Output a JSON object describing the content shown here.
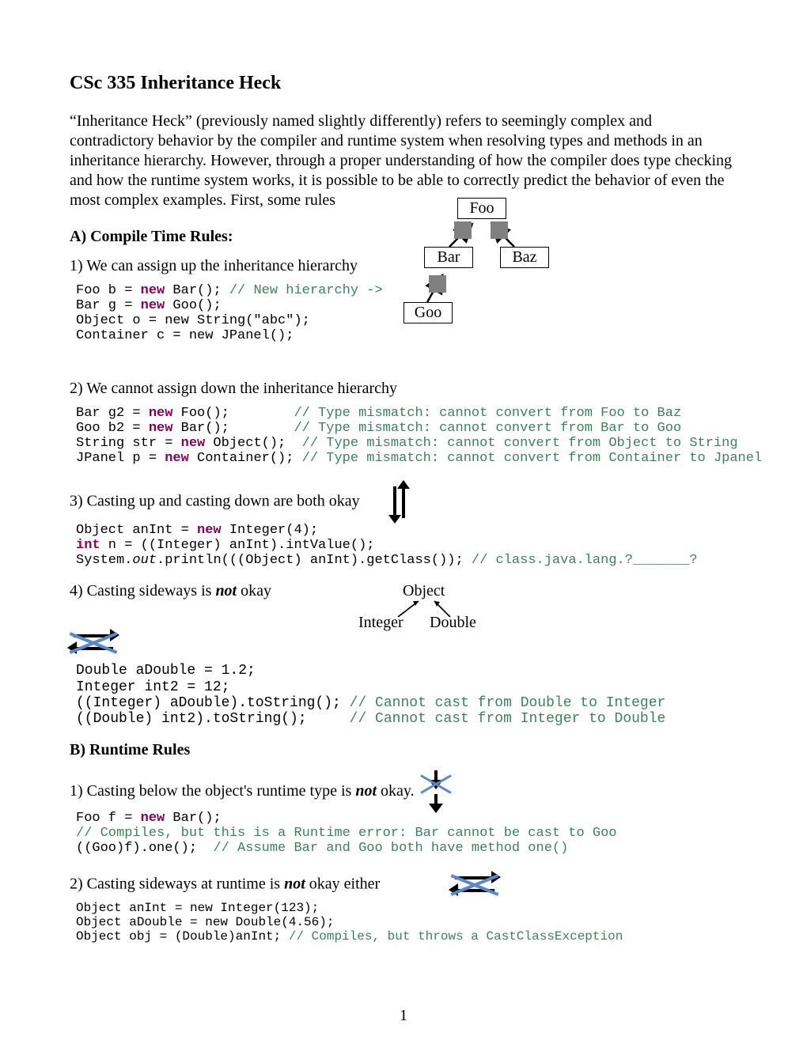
{
  "title": "CSc 335 Inheritance Heck",
  "intro": "“Inheritance Heck” (previously named slightly differently) refers to seemingly complex and contradictory behavior by the compiler and runtime system when resolving types and methods in an inheritance hierarchy. However, through a proper understanding of how the compiler does type checking and how the runtime system works, it is possible to be able to correctly predict the behavior of even the most complex examples. First, some rules",
  "sectionA": "A) Compile Time Rules:",
  "ruleA1": "1) We can assign up the inheritance hierarchy",
  "codeA1": {
    "l1a": "Foo b = ",
    "l1b": "new",
    "l1c": " Bar(); ",
    "l1d": "// New hierarchy ->",
    "l2a": "Bar g = ",
    "l2b": "new",
    "l2c": " Goo();",
    "l3": "Object o = new String(\"abc\");",
    "l4": "Container c = new JPanel();"
  },
  "diagram1": {
    "foo": "Foo",
    "bar": "Bar",
    "baz": "Baz",
    "goo": "Goo"
  },
  "ruleA2": "2) We cannot assign down the inheritance hierarchy",
  "codeA2": {
    "l1a": "Bar g2 = ",
    "l1b": "new",
    "l1c": " Foo();        ",
    "l1d": "// Type mismatch: cannot convert from Foo to Baz",
    "l2a": "Goo b2 = ",
    "l2b": "new",
    "l2c": " Bar();        ",
    "l2d": "// Type mismatch: cannot convert from Bar to Goo",
    "l3a": "String str = ",
    "l3b": "new",
    "l3c": " Object();  ",
    "l3d": "// Type mismatch: cannot convert from Object to String",
    "l4a": "JPanel p = ",
    "l4b": "new",
    "l4c": " Container(); ",
    "l4d": "// Type mismatch: cannot convert from Container to Jpanel"
  },
  "ruleA3": "3) Casting up and casting down are both okay",
  "codeA3": {
    "l1a": "Object anInt = ",
    "l1b": "new",
    "l1c": " Integer(4);",
    "l2a": "int",
    "l2b": " n = ((Integer) anInt).intValue();",
    "l3a": "System.",
    "l3b": "out",
    "l3c": ".println(((Object) anInt).getClass()); ",
    "l3d": "// class.java.lang.?_______?"
  },
  "ruleA4a": "4) Casting sideways is ",
  "ruleA4b": "not",
  "ruleA4c": " okay",
  "tree": {
    "object": "Object",
    "integer": "Integer",
    "double": "Double"
  },
  "codeA4": {
    "l1": "Double aDouble = 1.2;",
    "l2": "Integer int2 = 12;",
    "l3a": "((Integer) aDouble).toString(); ",
    "l3b": "// Cannot cast from Double to Integer",
    "l4a": "((Double) int2).toString();     ",
    "l4b": "// Cannot cast from Integer to Double"
  },
  "sectionB": "B)  Runtime Rules",
  "ruleB1a": "1) Casting below the object's runtime type is ",
  "ruleB1b": "not",
  "ruleB1c": " okay.",
  "codeB1": {
    "l1a": "Foo f = ",
    "l1b": "new",
    "l1c": " Bar();",
    "l2": "// Compiles, but this is a Runtime error: Bar cannot be cast to Goo",
    "l3a": "((Goo)f).one();  ",
    "l3b": "// Assume Bar and Goo both have method one()"
  },
  "ruleB2a": "2) Casting sideways at runtime is ",
  "ruleB2b": "not",
  "ruleB2c": " okay either",
  "codeB2": {
    "l1": "Object anInt = new Integer(123);",
    "l2": "Object aDouble = new Double(4.56);",
    "l3a": "Object obj = (Double)anInt; ",
    "l3b": "// Compiles, but throws a CastClassException"
  },
  "pageNumber": "1"
}
